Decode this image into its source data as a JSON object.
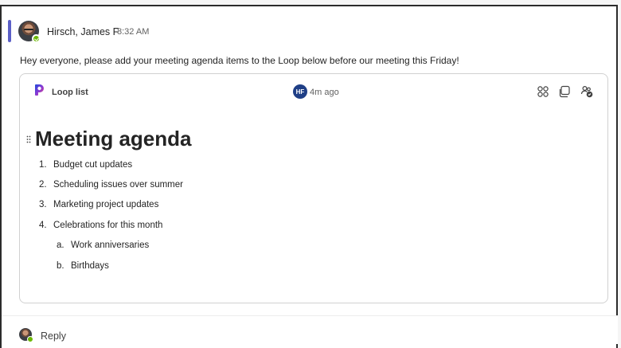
{
  "message": {
    "author": "Hirsch, James F",
    "time": "8:32 AM",
    "text": "Hey everyone, please add your meeting agenda items to the Loop below before our meeting this Friday!"
  },
  "loop_card": {
    "label": "Loop list",
    "editor_initials": "HF",
    "updated": "4m ago",
    "title": "Meeting agenda",
    "items": [
      {
        "num": "1.",
        "text": "Budget cut updates"
      },
      {
        "num": "2.",
        "text": "Scheduling issues over summer"
      },
      {
        "num": "3.",
        "text": "Marketing project updates"
      },
      {
        "num": "4.",
        "text": "Celebrations for this month"
      }
    ],
    "sub_items": [
      {
        "num": "a.",
        "text": "Work anniversaries"
      },
      {
        "num": "b.",
        "text": "Birthdays"
      }
    ],
    "actions": [
      "loop-components-icon",
      "copy-link-icon",
      "share-access-icon"
    ]
  },
  "reply": {
    "label": "Reply"
  },
  "colors": {
    "accent": "#5b5fc7",
    "presence": "#6bb700",
    "hf_badge": "#1f3f86"
  }
}
